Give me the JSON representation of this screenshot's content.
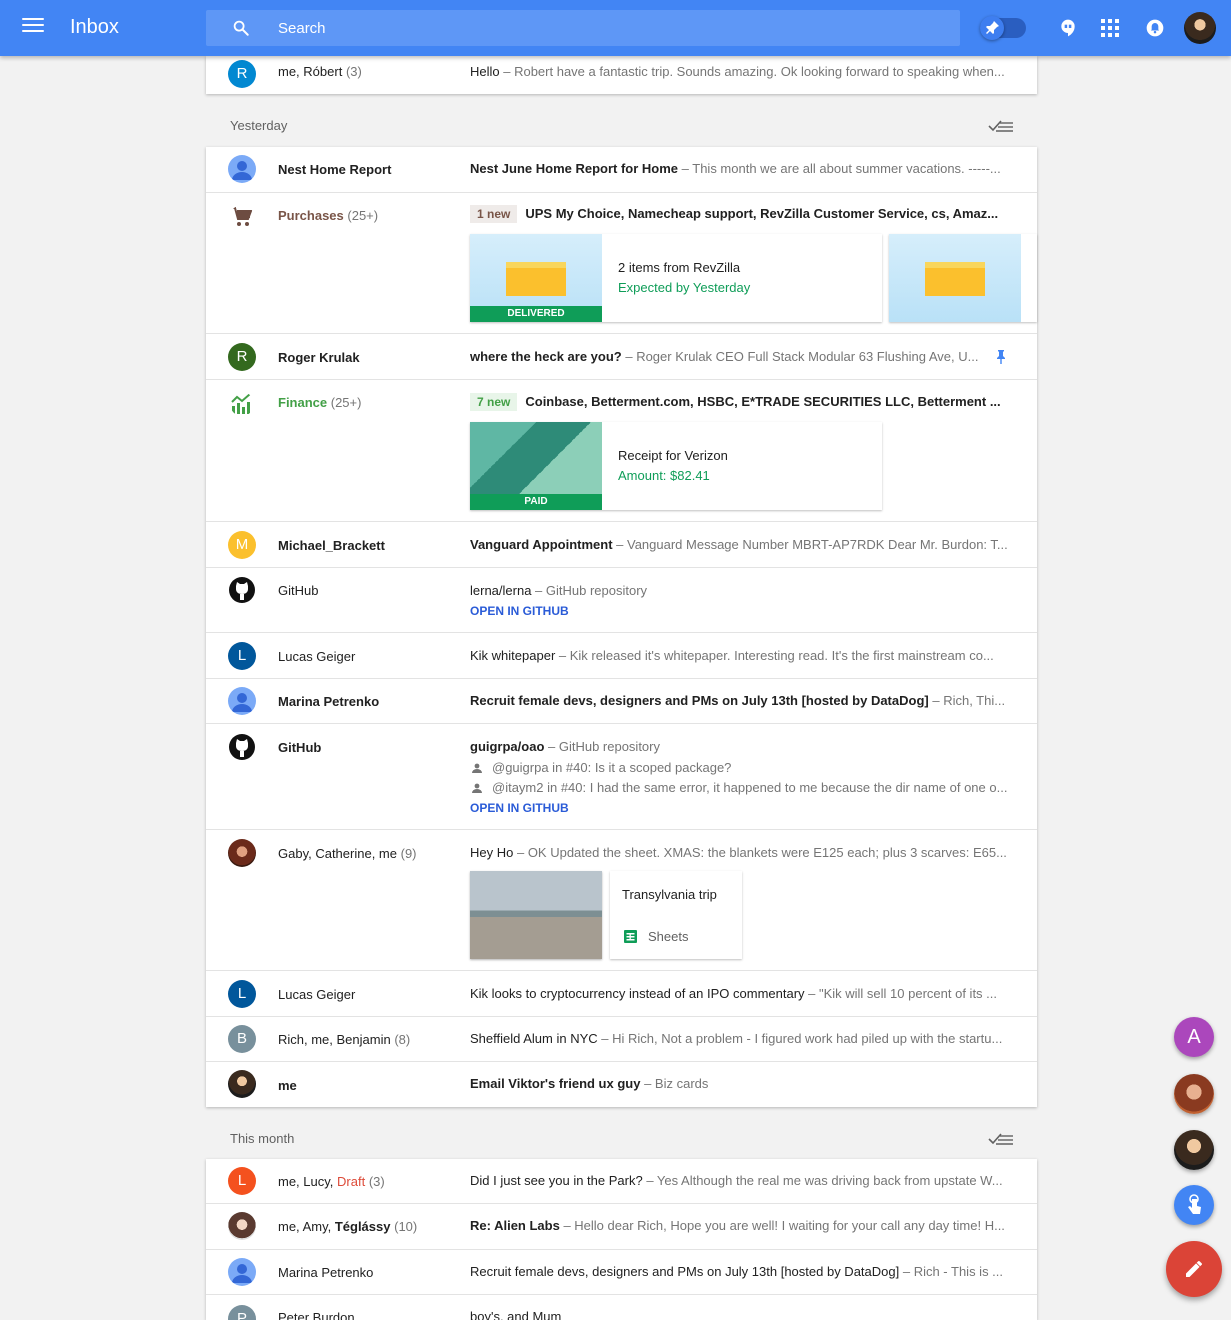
{
  "app": {
    "title": "Inbox"
  },
  "search": {
    "placeholder": "Search"
  },
  "icons": {
    "menu": "menu-icon",
    "search": "search-icon",
    "pin": "pin-icon",
    "hangouts": "hangouts-icon",
    "apps": "apps-grid-icon",
    "notifications": "bell-icon"
  },
  "colors": {
    "topbar": "#4285f4",
    "purchases": "#795548",
    "finance": "#43a047",
    "delivered": "#0f9d58",
    "compose": "#db4437"
  },
  "top_rows": [
    {
      "avatar": "R",
      "sender": "me, Róbert",
      "count": "(3)",
      "subject": "Hello",
      "snippet": " – Robert have a fantastic trip. Sounds amazing. Ok looking forward to speaking when..."
    }
  ],
  "sections": {
    "yesterday": "Yesterday",
    "this_month": "This month"
  },
  "yesterday_rows": {
    "nest": {
      "sender": "Nest Home Report",
      "subject": "Nest June Home Report for Home",
      "snippet": " – This month we are all about summer vacations. -----..."
    },
    "purchases": {
      "sender": "Purchases",
      "count": "(25+)",
      "badge": "1 new",
      "subject": "UPS My Choice, Namecheap support, RevZilla Customer Service, cs, Amaz...",
      "card": {
        "title": "2 items from RevZilla",
        "status": "Expected by Yesterday",
        "label": "DELIVERED"
      }
    },
    "roger": {
      "avatar": "R",
      "sender": "Roger Krulak",
      "subject": "where the heck are you?",
      "snippet": " – Roger Krulak CEO Full Stack Modular 63 Flushing Ave, U..."
    },
    "finance": {
      "sender": "Finance",
      "count": "(25+)",
      "badge": "7 new",
      "subject": "Coinbase, Betterment.com, HSBC, E*TRADE SECURITIES LLC, Betterment ...",
      "card": {
        "title": "Receipt for Verizon",
        "amount": "Amount: $82.41",
        "label": "PAID"
      }
    },
    "michael": {
      "avatar": "M",
      "sender": "Michael_Brackett",
      "subject": "Vanguard Appointment",
      "snippet": " – Vanguard Message Number MBRT-AP7RDK Dear Mr. Burdon: T..."
    },
    "github1": {
      "sender": "GitHub",
      "subject": "lerna/lerna",
      "snippet": " – GitHub repository",
      "action": "OPEN IN GITHUB"
    },
    "lucas1": {
      "avatar": "L",
      "sender": "Lucas Geiger",
      "subject": "Kik whitepaper",
      "snippet": " – Kik released it's whitepaper. Interesting read. It's the first mainstream co..."
    },
    "marina1": {
      "sender": "Marina Petrenko",
      "subject": "Recruit female devs, designers and PMs on July 13th [hosted by DataDog]",
      "snippet": " – Rich, Thi..."
    },
    "github2": {
      "sender": "GitHub",
      "subject": "guigrpa/oao",
      "snippet": " – GitHub repository",
      "comment1": "@guigrpa in #40: Is it a scoped package?",
      "comment2": "@itaym2 in #40: I had the same error, it happened to me because the dir name of one o...",
      "action": "OPEN IN GITHUB"
    },
    "gaby": {
      "sender": "Gaby, Catherine, me",
      "count": "(9)",
      "subject": "Hey Ho",
      "snippet": " – OK Updated the sheet. XMAS: the blankets were E125 each; plus 3 scarves: E65...",
      "attachment_title": "Transylvania trip",
      "attachment_app": "Sheets"
    },
    "lucas2": {
      "avatar": "L",
      "sender": "Lucas Geiger",
      "subject": "Kik looks to cryptocurrency instead of an IPO commentary",
      "snippet": " – \"Kik will sell 10 percent of its ..."
    },
    "rich": {
      "avatar": "B",
      "sender": "Rich, me, Benjamin",
      "count": "(8)",
      "subject": "Sheffield Alum in NYC",
      "snippet": " – Hi Rich, Not a problem - I figured work had piled up with the startu..."
    },
    "me": {
      "sender": "me",
      "subject": "Email Viktor's friend ux guy",
      "snippet": " – Biz cards"
    }
  },
  "month_rows": {
    "lucy": {
      "avatar": "L",
      "sender": "me, Lucy, ",
      "draft": "Draft",
      "count": "(3)",
      "subject": "Did I just see you in the Park?",
      "snippet": " – Yes Although the real me was driving back from upstate W..."
    },
    "amy": {
      "sender": "me, Amy, ",
      "sender_bold": "Téglássy",
      "count": "(10)",
      "subject": "Re: Alien Labs",
      "snippet": " – Hello dear Rich, Hope you are well! I waiting for your call any day time! H..."
    },
    "marina2": {
      "sender": "Marina Petrenko",
      "subject": "Recruit female devs, designers and PMs on July 13th [hosted by DataDog]",
      "snippet": " – Rich - This is ..."
    },
    "peter": {
      "avatar": "P",
      "sender": "Peter Burdon",
      "subject": "boy's, and Mum",
      "snippet": ""
    }
  },
  "fab": {
    "avatar_a": "A"
  }
}
